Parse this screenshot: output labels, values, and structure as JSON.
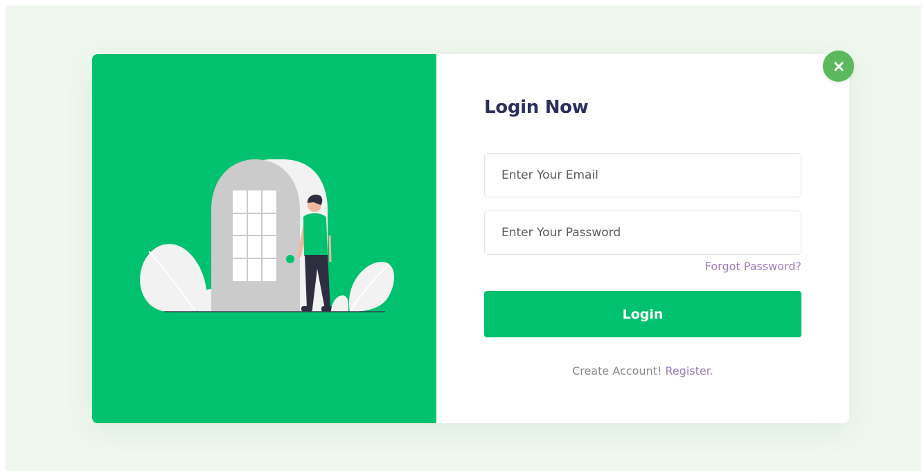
{
  "form": {
    "title": "Login Now",
    "email_placeholder": "Enter Your Email",
    "password_placeholder": "Enter Your Password",
    "forgot_password_label": "Forgot Password?",
    "login_button_label": "Login",
    "create_account_text": "Create Account!",
    "register_link_label": "Register."
  },
  "close_button": {
    "icon": "close-icon"
  },
  "illustration": {
    "description_icon": "door-person-illustration"
  },
  "colors": {
    "brand_green": "#00c16e",
    "close_green": "#5cb85c",
    "title_navy": "#2b2f5c",
    "link_purple": "#a07bbf",
    "background": "#eff7ee"
  }
}
